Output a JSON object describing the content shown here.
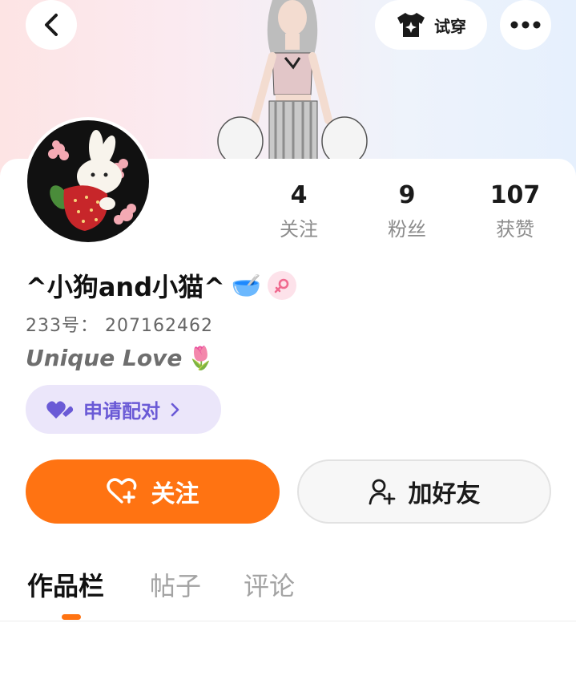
{
  "header": {
    "tryon_label": "试穿",
    "back_icon": "chevron-left-icon",
    "more_icon": "more-dots-icon",
    "tryon_icon": "tshirt-sparkle-icon"
  },
  "profile": {
    "name": "^小狗and小猫^",
    "name_emoji": "🥣",
    "gender_icon": "female-icon",
    "id_text": "233号： 207162462",
    "bio_text": "Unique Love",
    "bio_emoji": "🌷"
  },
  "stats": [
    {
      "value": "4",
      "label": "关注"
    },
    {
      "value": "9",
      "label": "粉丝"
    },
    {
      "value": "107",
      "label": "获赞"
    }
  ],
  "match": {
    "label": "申请配对"
  },
  "actions": {
    "follow_label": "关注",
    "add_friend_label": "加好友"
  },
  "tabs": [
    {
      "label": "作品栏",
      "active": true
    },
    {
      "label": "帖子",
      "active": false
    },
    {
      "label": "评论",
      "active": false
    }
  ],
  "colors": {
    "accent": "#ff7312",
    "match_bg": "#ebe6fa",
    "match_text": "#6a5ad6",
    "gender_pink": "#f06a8f"
  }
}
